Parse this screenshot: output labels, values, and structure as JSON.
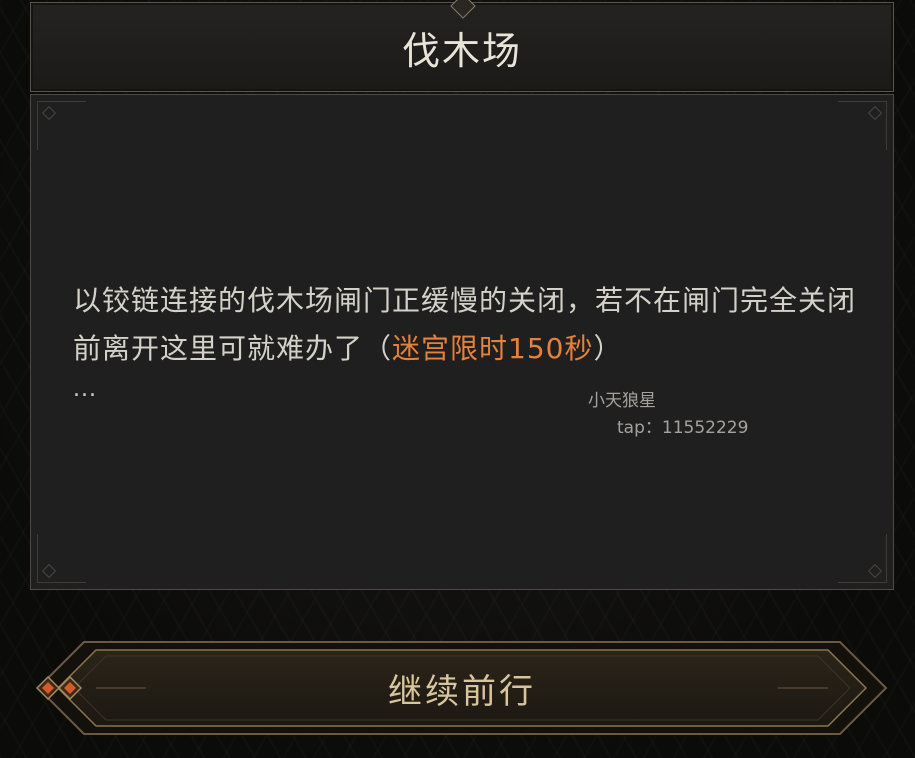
{
  "title": "伐木场",
  "message": {
    "line_part1": "以铰链连接的伐木场闸门正缓慢的关闭，若不在闸门完全关闭前离开这里可就难办了",
    "paren_open": "（",
    "highlight": "迷宫限时150秒",
    "paren_close": "）",
    "trailing": "...",
    "highlight_color": "#e4813a"
  },
  "watermark": {
    "name": "小天狼星",
    "tap": "tap：11552229"
  },
  "continue_button": {
    "label": "继续前行",
    "gem_color": "#d35b2a"
  }
}
